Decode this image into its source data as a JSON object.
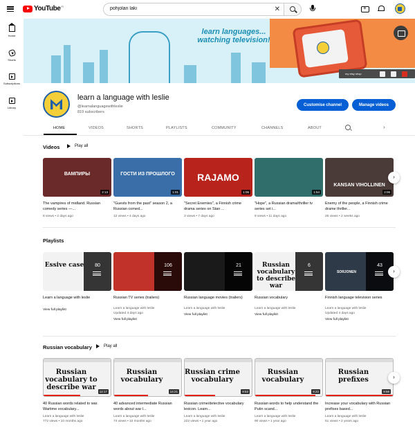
{
  "topbar": {
    "logo_text": "YouTube",
    "country_code": "FI",
    "search_value": "pohjolan laki"
  },
  "rail": [
    {
      "label": "Home",
      "icon": "home-icon"
    },
    {
      "label": "Shorts",
      "icon": "shorts-icon"
    },
    {
      "label": "Subscriptions",
      "icon": "subscriptions-icon"
    },
    {
      "label": "Library",
      "icon": "library-icon"
    }
  ],
  "banner": {
    "tagline": "learn languages... watching television!",
    "shop_link": "my etsy shop",
    "accent_color": "#f48b44"
  },
  "channel": {
    "name": "learn a language with leslie",
    "handle": "@learnalanguagewithleslie",
    "subscribers": "819 subscribers",
    "customise_label": "Customise channel",
    "manage_label": "Manage videos"
  },
  "tabs": [
    "HOME",
    "VIDEOS",
    "SHORTS",
    "PLAYLISTS",
    "COMMUNITY",
    "CHANNELS",
    "ABOUT"
  ],
  "videos": {
    "title": "Videos",
    "play_all": "Play all",
    "items": [
      {
        "title": "The vampires of midland. Russian comedy series —...",
        "meta": "8 views • 2 days ago",
        "duration": "2:13",
        "thumb_text": "ВАМПИРЫ",
        "color": "#6b2a2a"
      },
      {
        "title": "\"Guests from the past\" season 2, a Russian comed...",
        "meta": "12 views • 4 days ago",
        "duration": "1:01",
        "thumb_text": "ГОСТИ ИЗ ПРОШЛОГО",
        "color": "#3a6ea8"
      },
      {
        "title": "\"Secret Enemies\", a Finnish crime drama series on Stan ...",
        "meta": "3 views • 7 days ago",
        "duration": "1:06",
        "thumb_text": "RAJAMO",
        "color": "#b8231c"
      },
      {
        "title": "\"Hope\", a Russian drama/thriller tv series set i...",
        "meta": "9 views • 11 days ago",
        "duration": "1:54",
        "thumb_text": "",
        "color": "#2f6e6a"
      },
      {
        "title": "Enemy of the people, a Finnish crime drame thriller...",
        "meta": "26 views • 2 weeks ago",
        "duration": "2:06",
        "thumb_text": "KANSAN VIHOLLINEN",
        "color": "#4a3a38"
      }
    ]
  },
  "playlists": {
    "title": "Playlists",
    "items": [
      {
        "title": "Learn a language with leslie",
        "meta": "",
        "link": "View full playlist",
        "count": "80",
        "thumb_text": "Essive case",
        "color": "#f2f2f2"
      },
      {
        "title": "Russian TV series (trailers)",
        "meta": "Learn a language with leslie\nUpdated 4 days ago",
        "link": "View full playlist",
        "count": "106",
        "thumb_text": "",
        "color": "#c0322a"
      },
      {
        "title": "Russian language movies (trailers)",
        "meta": "Learn a language with leslie",
        "link": "View full playlist",
        "count": "21",
        "thumb_text": "",
        "color": "#1a1a1a"
      },
      {
        "title": "Russian vocabulary",
        "meta": "Learn a language with leslie",
        "link": "View full playlist",
        "count": "6",
        "thumb_text": "Russian vocabulary to describe war",
        "color": "#f2f2f2"
      },
      {
        "title": "Finnish language television series",
        "meta": "Learn a language with leslie\nUpdated 4 days ago",
        "link": "View full playlist",
        "count": "43",
        "thumb_text": "SORJONEN",
        "color": "#2e3a48"
      }
    ]
  },
  "russian_vocab": {
    "title": "Russian vocabulary",
    "play_all": "Play all",
    "items": [
      {
        "title": "40 Russian words related to war. Wartime vocabulary...",
        "channel": "Learn a language with leslie",
        "meta": "772 views • 10 months ago",
        "duration": "12:17",
        "thumb_text": "Russian vocabulary to describe war",
        "progress": 0.55
      },
      {
        "title": "40 advanced intermediate Russian words about war l...",
        "channel": "Learn a language with leslie",
        "meta": "74 views • 10 months ago",
        "duration": "14:21",
        "thumb_text": "Russian vocabulary",
        "progress": 0.5
      },
      {
        "title": "Russian crime/detective vocabulary lexicon. Learn...",
        "channel": "Learn a language with leslie",
        "meta": "222 views • 1 year ago",
        "duration": "9:53",
        "thumb_text": "Russian crime vocabulary",
        "progress": 0.45
      },
      {
        "title": "Russian words to help understand the Putin scand...",
        "channel": "Learn a language with leslie",
        "meta": "90 views • 1 year ago",
        "duration": "9:22",
        "thumb_text": "Russian vocabulary",
        "progress": 0.9
      },
      {
        "title": "Increase your vocabulary with Russian prefixes based...",
        "channel": "Learn a language with leslie",
        "meta": "51 views • 2 years ago",
        "duration": "9:58",
        "thumb_text": "Russian prefixes",
        "progress": 1.0
      }
    ]
  }
}
